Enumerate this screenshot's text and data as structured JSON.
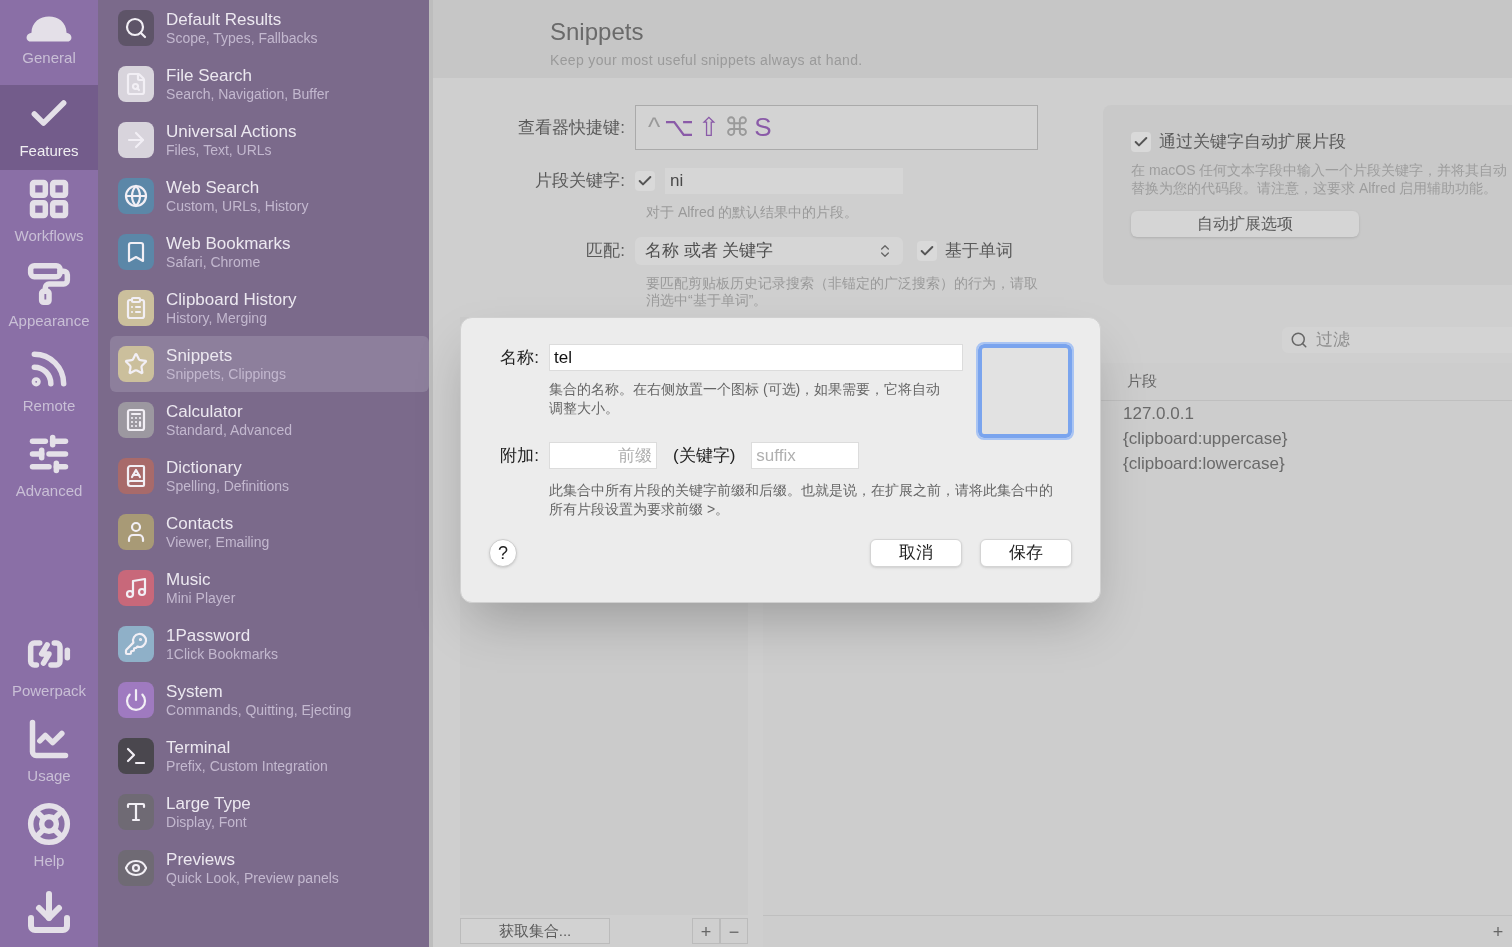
{
  "nav": [
    {
      "label": "General",
      "selected": false
    },
    {
      "label": "Features",
      "selected": true
    },
    {
      "label": "Workflows",
      "selected": false
    },
    {
      "label": "Appearance",
      "selected": false
    },
    {
      "label": "Remote",
      "selected": false
    },
    {
      "label": "Advanced",
      "selected": false
    },
    {
      "label": "Powerpack",
      "selected": false
    },
    {
      "label": "Usage",
      "selected": false
    },
    {
      "label": "Help",
      "selected": false
    }
  ],
  "features": [
    {
      "title": "Default Results",
      "subtitle": "Scope, Types, Fallbacks",
      "selected": false
    },
    {
      "title": "File Search",
      "subtitle": "Search, Navigation, Buffer",
      "selected": false
    },
    {
      "title": "Universal Actions",
      "subtitle": "Files, Text, URLs",
      "selected": false
    },
    {
      "title": "Web Search",
      "subtitle": "Custom, URLs, History",
      "selected": false
    },
    {
      "title": "Web Bookmarks",
      "subtitle": "Safari, Chrome",
      "selected": false
    },
    {
      "title": "Clipboard History",
      "subtitle": "History, Merging",
      "selected": false
    },
    {
      "title": "Snippets",
      "subtitle": "Snippets, Clippings",
      "selected": true
    },
    {
      "title": "Calculator",
      "subtitle": "Standard, Advanced",
      "selected": false
    },
    {
      "title": "Dictionary",
      "subtitle": "Spelling, Definitions",
      "selected": false
    },
    {
      "title": "Contacts",
      "subtitle": "Viewer, Emailing",
      "selected": false
    },
    {
      "title": "Music",
      "subtitle": "Mini Player",
      "selected": false
    },
    {
      "title": "1Password",
      "subtitle": "1Click Bookmarks",
      "selected": false
    },
    {
      "title": "System",
      "subtitle": "Commands, Quitting, Ejecting",
      "selected": false
    },
    {
      "title": "Terminal",
      "subtitle": "Prefix, Custom Integration",
      "selected": false
    },
    {
      "title": "Large Type",
      "subtitle": "Display, Font",
      "selected": false
    },
    {
      "title": "Previews",
      "subtitle": "Quick Look, Preview panels",
      "selected": false
    }
  ],
  "header": {
    "title": "Snippets",
    "subtitle": "Keep your most useful snippets always at hand."
  },
  "viewer_hotkey": {
    "label": "查看器快捷键:",
    "keys": [
      {
        "key": "^",
        "active": false
      },
      {
        "key": "⌥",
        "active": true
      },
      {
        "key": "⇧",
        "active": true
      },
      {
        "key": "⌘",
        "active": false
      },
      {
        "key": "S",
        "active": true
      }
    ]
  },
  "snippet_keyword": {
    "label": "片段关键字:",
    "checked": true,
    "value": "ni",
    "hint": "对于 Alfred 的默认结果中的片段。"
  },
  "match": {
    "label": "匹配:",
    "value": "名称 或者 关键字",
    "word_based": {
      "label": "基于单词",
      "checked": true
    },
    "hint": "要匹配剪贴板历史记录搜索（非锚定的广泛搜索）的行为，请取消选中“基于单词”。"
  },
  "auto_expand": {
    "label": "通过关键字自动扩展片段",
    "checked": true,
    "description": "在 macOS 任何文本字段中输入一个片段关键字，并将其自动替换为您的代码段。请注意，这要求 Alfred 启用辅助功能。",
    "button": "自动扩展选项"
  },
  "filter": {
    "placeholder": "过滤"
  },
  "collections": {
    "fetch_button": "获取集合...",
    "add": "+",
    "remove": "−"
  },
  "snippets_table": {
    "columns": [
      "片段"
    ],
    "rows": [
      "127.0.0.1",
      "{clipboard:uppercase}",
      "{clipboard:lowercase}"
    ],
    "add": "+"
  },
  "dialog": {
    "name_label": "名称:",
    "name_value": "tel",
    "name_hint": "集合的名称。在右侧放置一个图标 (可选)，如果需要，它将自动调整大小。",
    "icon_well_focused": true,
    "affix_label": "附加:",
    "prefix_placeholder": "前缀",
    "keyword_label": "(关键字)",
    "suffix_placeholder": "suffix",
    "affix_hint": "此集合中所有片段的关键字前缀和后缀。也就是说，在扩展之前，请将此集合中的所有片段设置为要求前缀 >。",
    "help": "?",
    "buttons": [
      "取消",
      "保存"
    ]
  }
}
